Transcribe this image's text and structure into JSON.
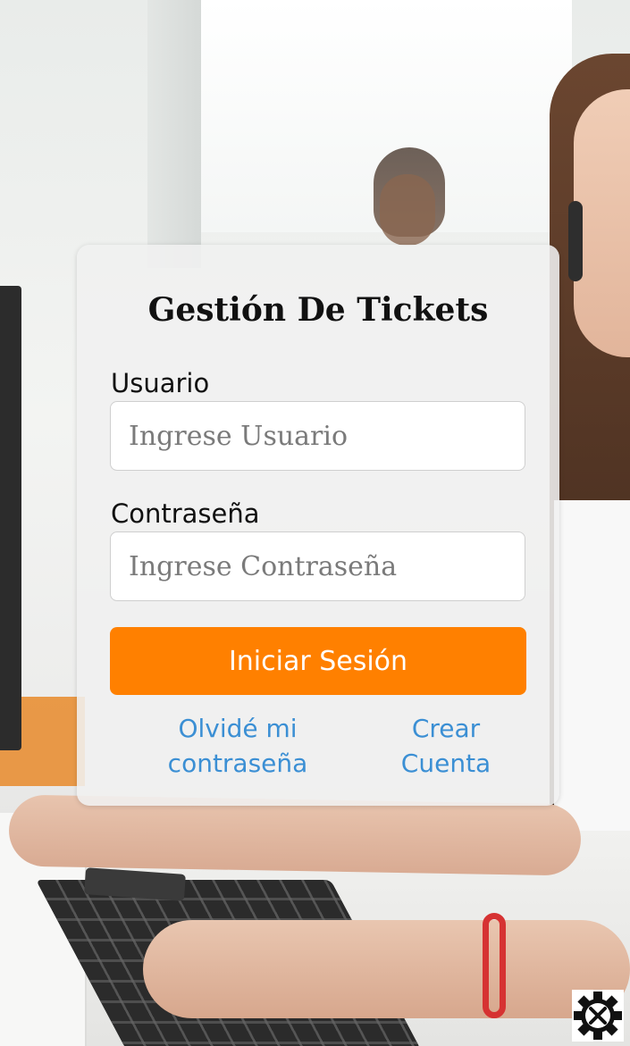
{
  "login": {
    "title": "Gestión De Tickets",
    "username_label": "Usuario",
    "username_placeholder": "Ingrese Usuario",
    "password_label": "Contraseña",
    "password_placeholder": "Ingrese Contraseña",
    "submit_label": "Iniciar Sesión",
    "forgot_line1": "Olvidé mi",
    "forgot_line2": "contraseña",
    "create_line1": "Crear",
    "create_line2": "Cuenta"
  },
  "colors": {
    "accent": "#ff8000",
    "link": "#3b8fd4"
  },
  "icons": {
    "corner": "gear-tools-icon"
  }
}
